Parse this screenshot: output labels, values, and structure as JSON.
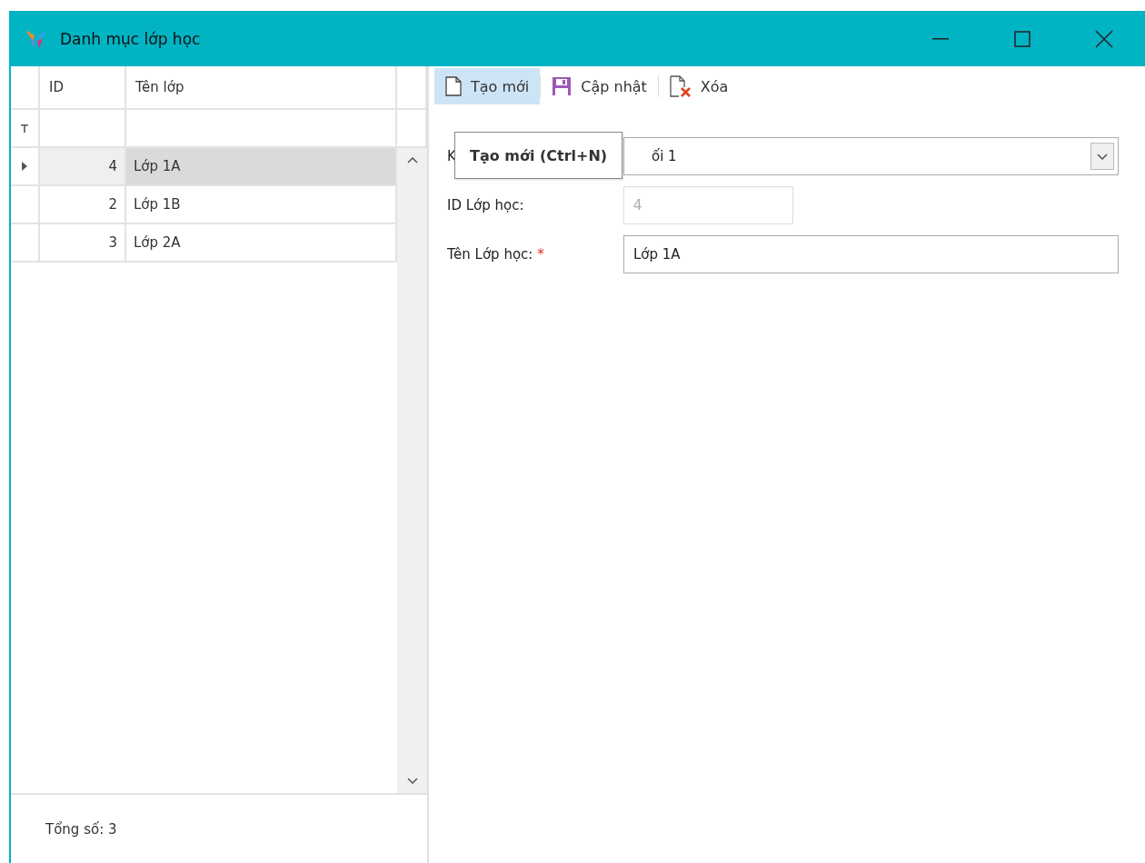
{
  "window": {
    "title": "Danh mục lớp học"
  },
  "grid": {
    "columns": [
      {
        "label": "ID"
      },
      {
        "label": "Tên lớp"
      }
    ],
    "rows": [
      {
        "id": "4",
        "name": "Lớp 1A",
        "selected": true
      },
      {
        "id": "2",
        "name": "Lớp 1B",
        "selected": false
      },
      {
        "id": "3",
        "name": "Lớp 2A",
        "selected": false
      }
    ],
    "footer": "Tổng số: 3"
  },
  "toolbar": [
    {
      "kind": "new",
      "label": "Tạo mới",
      "highlighted": true
    },
    {
      "kind": "save",
      "label": "Cập nhật",
      "highlighted": false
    },
    {
      "kind": "delete",
      "label": "Xóa",
      "highlighted": false
    }
  ],
  "form": [
    {
      "kind": "combo",
      "label": "K",
      "value": "ối 1"
    },
    {
      "kind": "text",
      "label": "ID Lớp học:",
      "value": "4",
      "disabled": true
    },
    {
      "kind": "text",
      "label": "Tên Lớp học:",
      "value": "Lớp 1A",
      "disabled": false,
      "required_mark": "*"
    }
  ],
  "tooltip": "Tạo mới (Ctrl+N)"
}
